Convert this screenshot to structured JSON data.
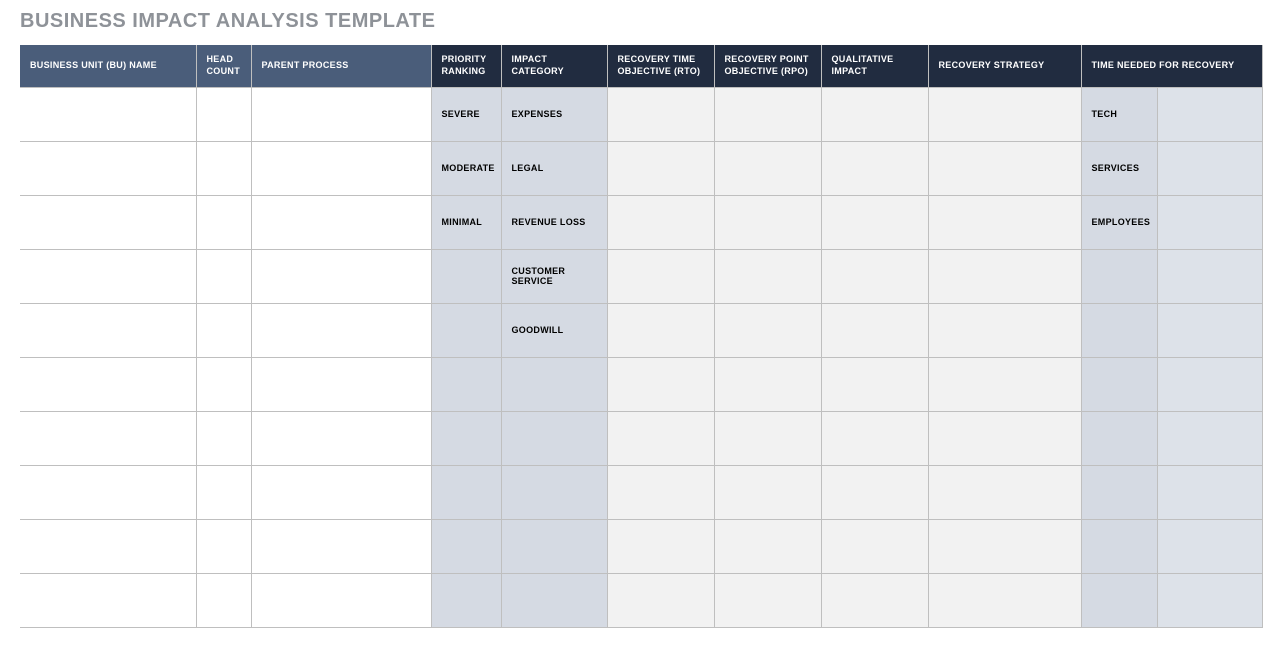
{
  "title": "BUSINESS IMPACT ANALYSIS TEMPLATE",
  "headers": {
    "bu": "BUSINESS UNIT (BU) NAME",
    "head": "HEAD COUNT",
    "parent": "PARENT PROCESS",
    "priority": "PRIORITY RANKING",
    "impact": "IMPACT CATEGORY",
    "rto": "RECOVERY TIME OBJECTIVE (RTO)",
    "rpo": "RECOVERY POINT OBJECTIVE (RPO)",
    "qual": "QUALITATIVE IMPACT",
    "strategy": "RECOVERY STRATEGY",
    "time": "TIME NEEDED FOR RECOVERY"
  },
  "priority_values": [
    "SEVERE",
    "MODERATE",
    "MINIMAL",
    "",
    "",
    "",
    "",
    "",
    "",
    ""
  ],
  "impact_values": [
    "EXPENSES",
    "LEGAL",
    "REVENUE LOSS",
    "CUSTOMER SERVICE",
    "GOODWILL",
    "",
    "",
    "",
    "",
    ""
  ],
  "time_values": [
    "TECH",
    "SERVICES",
    "EMPLOYEES",
    "",
    "",
    "",
    "",
    "",
    "",
    ""
  ]
}
